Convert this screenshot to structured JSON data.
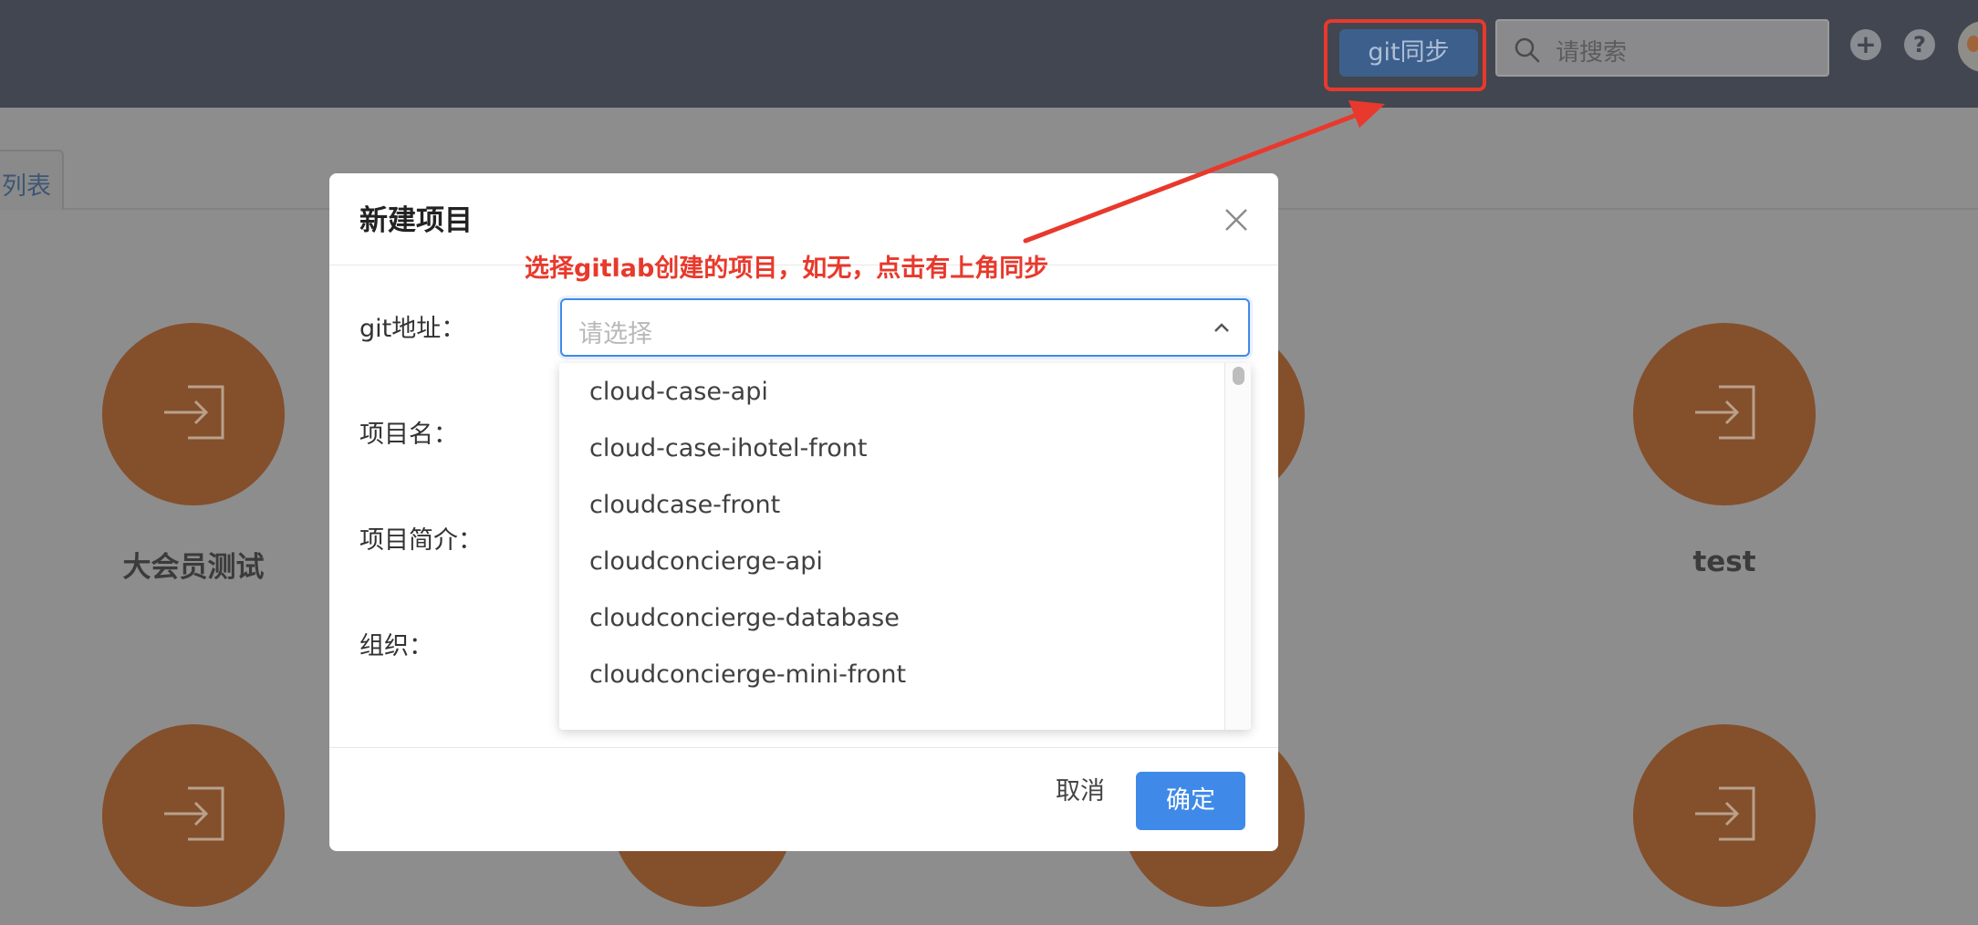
{
  "header": {
    "git_sync_label": "git同步",
    "search_placeholder": "请搜索",
    "add_icon": "plus-circle-icon",
    "help_icon": "question-circle-icon",
    "help_glyph": "?",
    "add_glyph": "+"
  },
  "tabs": [
    {
      "label": "列表"
    }
  ],
  "cards": [
    {
      "label": "大会员测试",
      "icon": "login-arrow-icon"
    },
    {
      "label": "test",
      "icon": "login-arrow-icon"
    }
  ],
  "modal": {
    "title": "新建项目",
    "close_icon": "close-icon",
    "fields": {
      "git_address": "git地址：",
      "project_name": "项目名：",
      "project_desc": "项目简介：",
      "organization": "组织："
    },
    "select_placeholder": "请选择",
    "dropdown_options": [
      "cloud-case-api",
      "cloud-case-ihotel-front",
      "cloudcase-front",
      "cloudconcierge-api",
      "cloudconcierge-database",
      "cloudconcierge-mini-front"
    ],
    "cancel_label": "取消",
    "ok_label": "确定"
  },
  "annotation": {
    "text": "选择gitlab创建的项目，如无，点击有上角同步"
  },
  "colors": {
    "header_bg": "#424650",
    "accent": "#3f8ae8",
    "annotation": "#e8392c",
    "card": "#844f2b"
  }
}
